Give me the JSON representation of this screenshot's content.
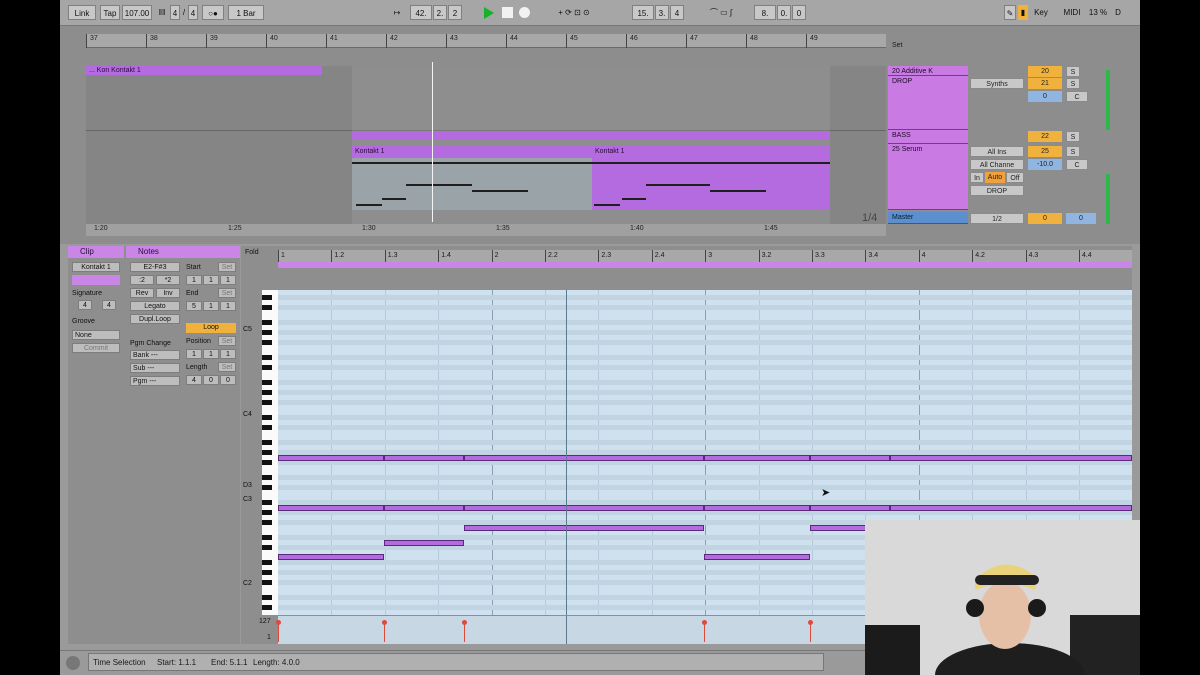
{
  "controlbar": {
    "link": "Link",
    "tap": "Tap",
    "tempo": "107.00",
    "sig_num": "4",
    "sig_den": "4",
    "metro": "○●",
    "quant": "1 Bar",
    "pos_bar": "42.",
    "pos_beat": "2.",
    "pos_sixteenth": "2",
    "loop_start": "15.",
    "loop_start_b": "3.",
    "loop_start_c": "4",
    "loop_len": "8.",
    "loop_len_b": "0.",
    "loop_len_c": "0",
    "key": "Key",
    "midi": "MIDI",
    "cpu": "13 %",
    "d": "D"
  },
  "arrangement": {
    "bars": [
      "37",
      "38",
      "39",
      "40",
      "41",
      "42",
      "43",
      "44",
      "45",
      "46",
      "47",
      "48",
      "49"
    ],
    "times": [
      "1:20",
      "1:25",
      "1:30",
      "1:35",
      "1:40",
      "1:45"
    ],
    "clip_top": "... Kon Kontakt 1",
    "clip_a": "Kontakt 1",
    "clip_b": "Kontakt 1",
    "zoom": "1/4",
    "set": "Set"
  },
  "tracks": [
    {
      "name": "20 Additive K",
      "vol": "20",
      "s": "S"
    },
    {
      "name": "DROP",
      "route": "Synths",
      "vol": "21",
      "s": "S",
      "pan": "0",
      "c": "C"
    },
    {
      "name": "BASS",
      "vol": "22",
      "s": "S"
    },
    {
      "name": "25 Serum",
      "input": "All Ins",
      "chan": "All Channe",
      "vol": "25",
      "s": "S",
      "pan": "-10.0",
      "c": "C",
      "mon_in": "In",
      "mon_auto": "Auto",
      "mon_off": "Off",
      "out": "DROP"
    },
    {
      "name": "Master",
      "out": "1/2",
      "vol": "0",
      "pan": "0"
    }
  ],
  "clipview": {
    "clip_tab": "Clip",
    "notes_tab": "Notes",
    "clip_name": "Kontakt 1",
    "signature": "Signature",
    "sig_num": "4",
    "sig_den": "4",
    "groove": "Groove",
    "groove_val": "None",
    "commit": "Commit",
    "range": "E2-F#3",
    "div2": ":2",
    "mul2": "*2",
    "rev": "Rev",
    "inv": "Inv",
    "legato": "Legato",
    "dupl": "Dupl.Loop",
    "start": "Start",
    "end": "End",
    "set": "Set",
    "start_vals": [
      "1",
      "1",
      "1"
    ],
    "end_vals": [
      "5",
      "1",
      "1"
    ],
    "loop": "Loop",
    "position": "Position",
    "pos_vals": [
      "1",
      "1",
      "1"
    ],
    "length": "Length",
    "len_vals": [
      "4",
      "0",
      "0"
    ],
    "pgm_change": "Pgm Change",
    "bank": "Bank ---",
    "sub": "Sub ---",
    "pgm": "Pgm ---"
  },
  "pianoroll": {
    "fold": "Fold",
    "beats": [
      "1",
      "1.2",
      "1.3",
      "1.4",
      "2",
      "2.2",
      "2.3",
      "2.4",
      "3",
      "3.2",
      "3.3",
      "3.4",
      "4",
      "4.2",
      "4.3",
      "4.4"
    ],
    "octaves": [
      "C5",
      "C4",
      "D3",
      "C3",
      "C2"
    ],
    "vel_max": "127",
    "vel_min": "1"
  },
  "status": {
    "label": "Time Selection",
    "start": "Start: 1.1.1",
    "end": "End: 5.1.1",
    "length": "Length: 4.0.0"
  },
  "colors": {
    "clip": "#b56be0",
    "grid": "#cfe1ee",
    "volume": "#f0b23c",
    "play": "#17b12a"
  }
}
